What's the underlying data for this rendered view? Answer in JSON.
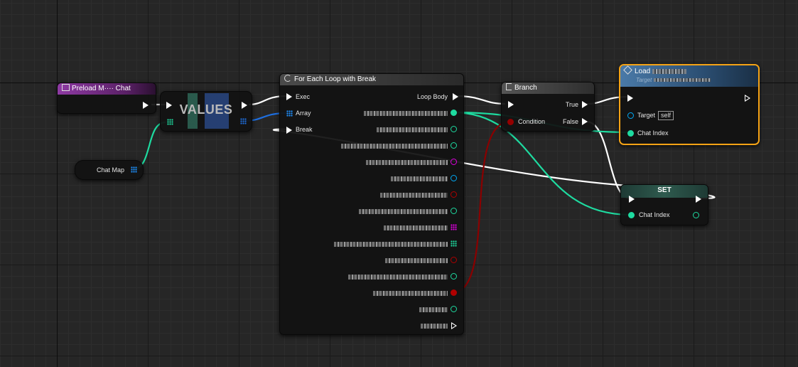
{
  "nodes": {
    "event": {
      "title": "Preload M···· Chat"
    },
    "values": {
      "title": "VALUES"
    },
    "chat_map": {
      "label": "Chat Map"
    },
    "for_each": {
      "title": "For Each Loop with Break",
      "inputs": {
        "exec": "Exec",
        "array": "Array",
        "break": "Break"
      },
      "outputs": {
        "loop_body": "Loop Body",
        "array_element": "Array Element Chat Key Index"
      }
    },
    "branch": {
      "title": "Branch",
      "condition": "Condition",
      "true_label": "True",
      "false_label": "False"
    },
    "load": {
      "title": "Load",
      "subtitle": "Target",
      "target_label": "Target",
      "target_value": "self",
      "chat_index": "Chat Index"
    },
    "set": {
      "title": "SET",
      "chat_index": "Chat Index"
    }
  },
  "colors": {
    "exec": "#ffffff",
    "int": "#1edba0",
    "bool": "#940000",
    "object": "#00a8f4",
    "struct": "#0057c8",
    "map_key": "#1e90ff",
    "magenta": "#e000e0",
    "event_header": "#7b2d8e",
    "selection": "#f5a315"
  },
  "icons": [
    "event-icon",
    "loop-icon",
    "branch-icon",
    "function-icon",
    "map-icon"
  ]
}
